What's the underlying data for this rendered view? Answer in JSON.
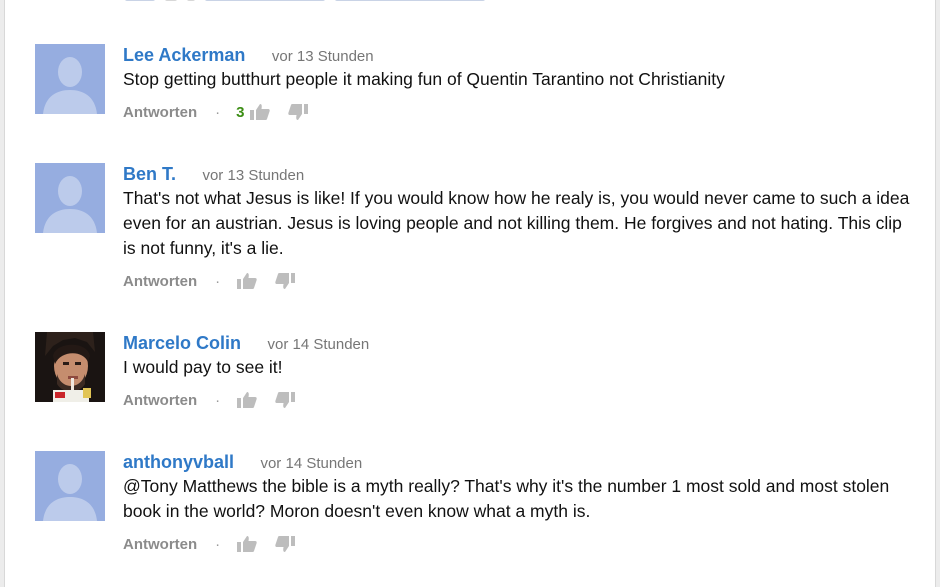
{
  "comments": [
    {
      "author": "Lee Ackerman",
      "time": "vor 13 Stunden",
      "text": "Stop getting butthurt people it making fun of Quentin Tarantino not Christianity",
      "reply": "Antworten",
      "likes": "3",
      "avatar": "default-avatar"
    },
    {
      "author": "Ben T.",
      "time": "vor 13 Stunden",
      "text": "That's not what Jesus is like! If you would know how he realy is, you would never came to such a idea even for an austrian. Jesus is loving people and not killing them. He forgives and not hating. This clip is not funny, it's a lie.",
      "reply": "Antworten",
      "likes": "",
      "avatar": "default-avatar"
    },
    {
      "author": "Marcelo Colin",
      "time": "vor 14 Stunden",
      "text": "I would pay to see it!",
      "reply": "Antworten",
      "likes": "",
      "avatar": "photo-avatar"
    },
    {
      "author": "anthonyvball",
      "time": "vor 14 Stunden",
      "text": "@Tony Matthews the bible is a myth really? That's why it's the number 1 most sold and most stolen book in the world? Moron doesn't even know what a myth is.",
      "reply": "Antworten",
      "likes": "",
      "avatar": "default-avatar"
    }
  ],
  "colors": {
    "author": "#2f79c7",
    "like_count": "#3c8e15",
    "avatar_default": "#96ade0",
    "meta": "#767676"
  },
  "icons": {
    "like": "thumbs-up-icon",
    "dislike": "thumbs-down-icon",
    "separator": "·"
  }
}
